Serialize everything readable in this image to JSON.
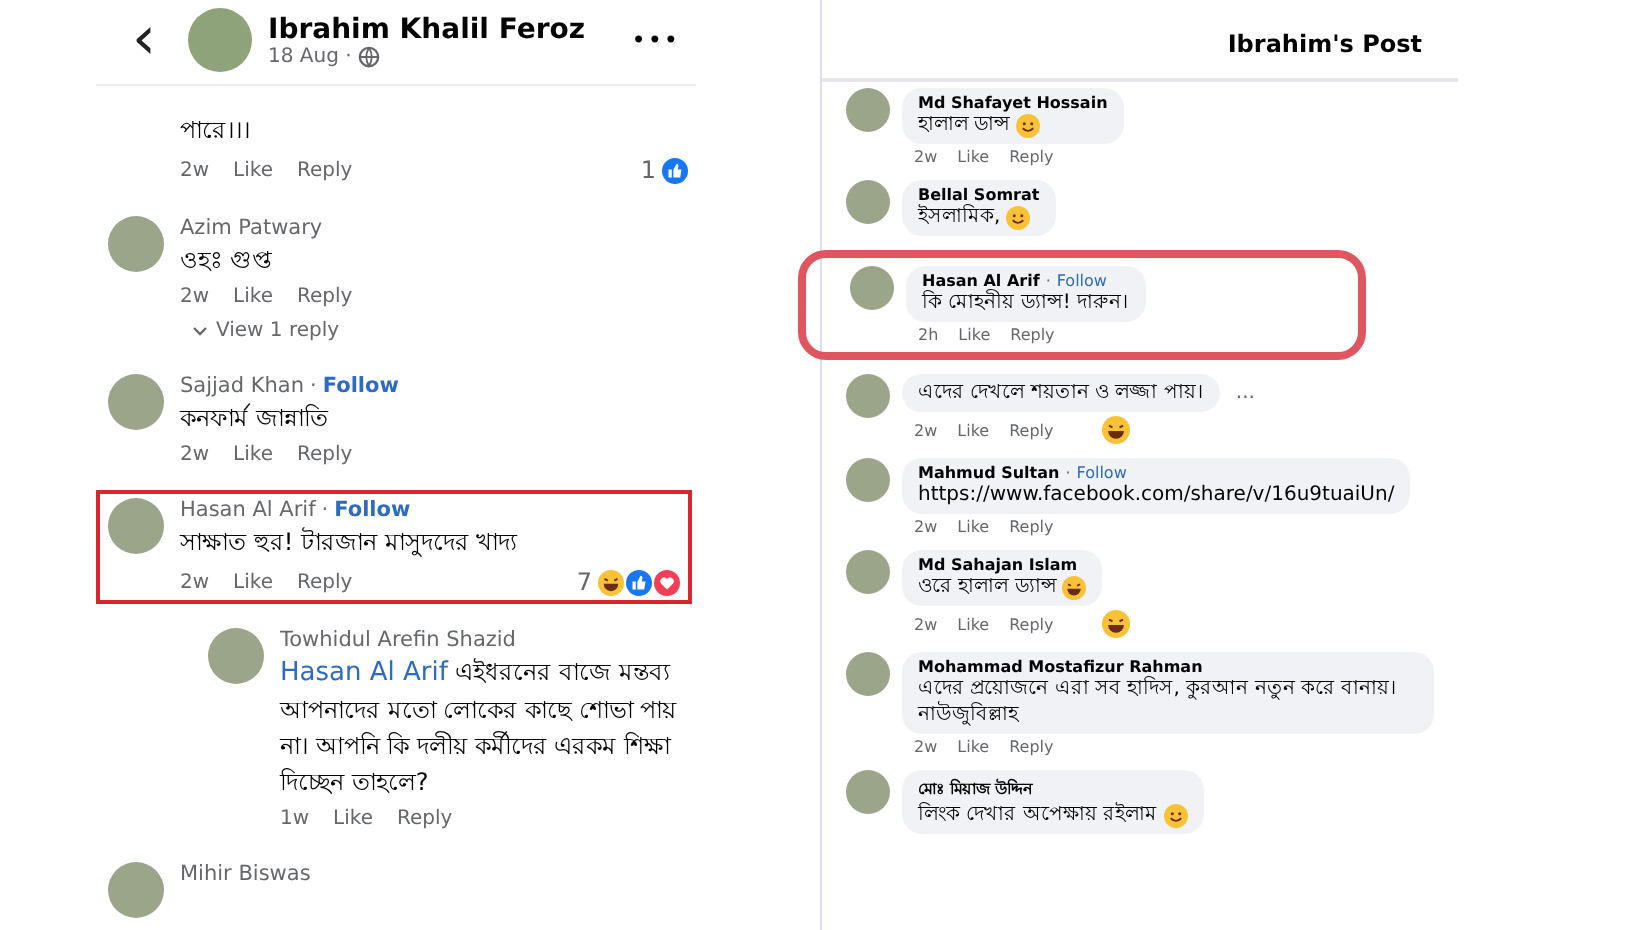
{
  "left": {
    "header": {
      "name": "Ibrahim Khalil Feroz",
      "time": "18 Aug ·",
      "menu": "•••",
      "back": "‹"
    },
    "comments": [
      {
        "text": "পারে।।।",
        "meta": [
          "2w",
          "Like",
          "Reply"
        ],
        "count": "1",
        "reactions": [
          {
            "kind": "like"
          }
        ],
        "highlighted": false,
        "reply": false
      },
      {
        "name": "Azim Patwary",
        "text": "ওহঃ গুপ্ত",
        "meta": [
          "2w",
          "Like",
          "Reply"
        ],
        "more": "View 1 reply",
        "highlighted": false,
        "reply": false
      },
      {
        "name": "Sajjad  Khan",
        "separator": "·",
        "follow": "Follow",
        "text": "কনফার্ম জান্নাতি",
        "meta": [
          "2w",
          "Like",
          "Reply"
        ],
        "highlighted": false,
        "reply": false
      },
      {
        "name": "Hasan Al Arif",
        "separator": "·",
        "follow": "Follow",
        "text": "সাক্ষাত হুর! টারজান মাসুদদের খাদ্য",
        "meta": [
          "2w",
          "Like",
          "Reply"
        ],
        "count": "7",
        "reactions": [
          {
            "kind": "laugh"
          },
          {
            "kind": "like"
          },
          {
            "kind": "love"
          }
        ],
        "highlighted": true,
        "reply": false
      },
      {
        "name": "Towhidul Arefin Shazid",
        "text": "**Hasan Al Arif** এইধরনের বাজে মন্তব্য আপনাদের মতো লোকের কাছে শোভা পায় না। আপনি কি দলীয় কর্মীদের এরকম শিক্ষা দিচ্ছেন তাহলে?",
        "meta": [
          "1w",
          "Like",
          "Reply"
        ],
        "highlighted": false,
        "reply": true
      },
      {
        "name": "Mihir Biswas",
        "highlighted": false,
        "reply": false
      }
    ]
  },
  "right": {
    "title": "Ibrahim's Post",
    "comments": [
      {
        "name": "Md Shafayet Hossain",
        "text": "হালাল ডান্স",
        "emoji": {
          "kind": "smile"
        },
        "meta": [
          "2w",
          "Like",
          "Reply"
        ],
        "highlighted": false
      },
      {
        "name": "Bellal Somrat",
        "text": "ইসলামিক,",
        "emoji": {
          "kind": "smile"
        },
        "highlighted": false
      },
      {
        "name": "Hasan Al Arif",
        "separator": "·",
        "follow": "Follow",
        "text": "কি মোহনীয় ড্যান্স! দারুন।",
        "meta": [
          "2h",
          "Like",
          "Reply"
        ],
        "highlighted": true
      },
      {
        "text": "এদের দেখলে শয়তান ও লজ্জা পায়।",
        "more": "...",
        "meta": [
          "2w",
          "Like",
          "Reply"
        ],
        "reaction": {
          "kind": "laugh"
        },
        "highlighted": false
      },
      {
        "name": "Mahmud Sultan",
        "separator": "·",
        "follow": "Follow",
        "text": "https://www.facebook.com/share/v/16u9tuaiUn/",
        "meta": [
          "2w",
          "Like",
          "Reply"
        ],
        "highlighted": false
      },
      {
        "name": "Md Sahajan Islam",
        "text": "ওরে হালাল ড্যান্স",
        "emoji": {
          "kind": "laugh"
        },
        "meta": [
          "2w",
          "Like",
          "Reply"
        ],
        "reaction": {
          "kind": "laugh"
        },
        "highlighted": false
      },
      {
        "name": "Mohammad Mostafizur Rahman",
        "text": "এদের প্রয়োজনে এরা সব হাদিস, কুরআন নতুন করে বানায়। নাউজুবিল্লাহ",
        "meta": [
          "2w",
          "Like",
          "Reply"
        ],
        "highlighted": false
      },
      {
        "name": "মোঃ মিয়াজ উদ্দিন",
        "text": "লিংক দেখার অপেক্ষায় রইলাম",
        "emoji": {
          "kind": "smile"
        },
        "highlighted": false
      }
    ]
  }
}
